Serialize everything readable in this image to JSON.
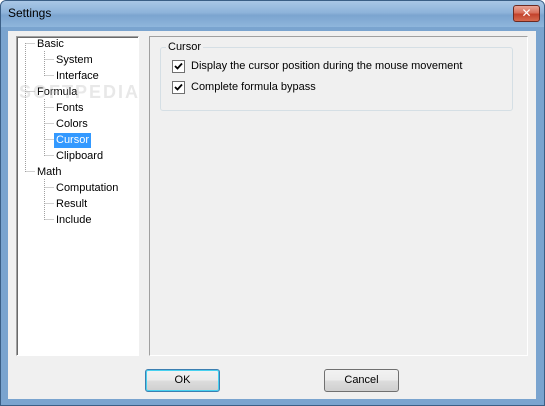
{
  "window": {
    "title": "Settings",
    "close_glyph": "✕"
  },
  "tree": {
    "items": [
      {
        "label": "Basic",
        "level": 0
      },
      {
        "label": "System",
        "level": 1
      },
      {
        "label": "Interface",
        "level": 1
      },
      {
        "label": "Formula",
        "level": 0
      },
      {
        "label": "Fonts",
        "level": 1
      },
      {
        "label": "Colors",
        "level": 1
      },
      {
        "label": "Cursor",
        "level": 1,
        "selected": true
      },
      {
        "label": "Clipboard",
        "level": 1
      },
      {
        "label": "Math",
        "level": 0
      },
      {
        "label": "Computation",
        "level": 1
      },
      {
        "label": "Result",
        "level": 1
      },
      {
        "label": "Include",
        "level": 1
      }
    ]
  },
  "cursor_group": {
    "title": "Cursor",
    "options": [
      {
        "label": "Display the cursor position during the mouse movement",
        "checked": true
      },
      {
        "label": "Complete formula bypass",
        "checked": true
      }
    ]
  },
  "buttons": {
    "ok_label": "OK",
    "cancel_label": "Cancel"
  },
  "watermark": {
    "text": "SOFTPEDIA"
  },
  "colors": {
    "selection": "#3399ff",
    "dialog_bg": "#f0f0f0",
    "title_bar": "#8db3da",
    "close_button": "#c3432c"
  }
}
